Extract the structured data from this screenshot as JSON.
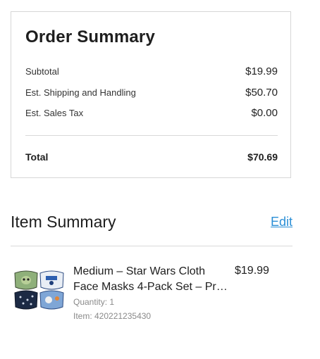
{
  "order_summary": {
    "title": "Order Summary",
    "subtotal": {
      "label": "Subtotal",
      "value": "$19.99"
    },
    "shipping": {
      "label": "Est. Shipping and Handling",
      "value": "$50.70"
    },
    "tax": {
      "label": "Est. Sales Tax",
      "value": "$0.00"
    },
    "total": {
      "label": "Total",
      "value": "$70.69"
    }
  },
  "item_summary": {
    "title": "Item Summary",
    "edit_label": "Edit",
    "items": [
      {
        "name_line1": "Medium – Star Wars Cloth",
        "name_line2": "Face Masks 4-Pack Set – Pre…",
        "price": "$19.99",
        "quantity": "Quantity: 1",
        "item_number": "Item: 420221235430",
        "image_icon": "face-masks-product-image"
      }
    ]
  },
  "colors": {
    "link": "#2b8fd6",
    "border": "#d6d6d6",
    "muted_text": "#8a8a8a"
  }
}
